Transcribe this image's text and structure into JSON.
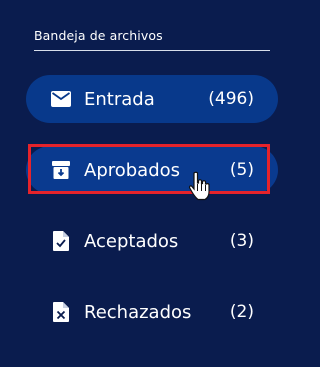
{
  "inbox": {
    "title": "Bandeja de archivos",
    "items": [
      {
        "label": "Entrada",
        "count": "(496)",
        "icon": "mail-icon"
      },
      {
        "label": "Aprobados",
        "count": "(5)",
        "icon": "archive-download-icon"
      },
      {
        "label": "Aceptados",
        "count": "(3)",
        "icon": "file-check-icon"
      },
      {
        "label": "Rechazados",
        "count": "(2)",
        "icon": "file-x-icon"
      }
    ]
  },
  "colors": {
    "background": "#0a1c4e",
    "active_pill": "#08398b",
    "highlight": "#e5232b"
  }
}
